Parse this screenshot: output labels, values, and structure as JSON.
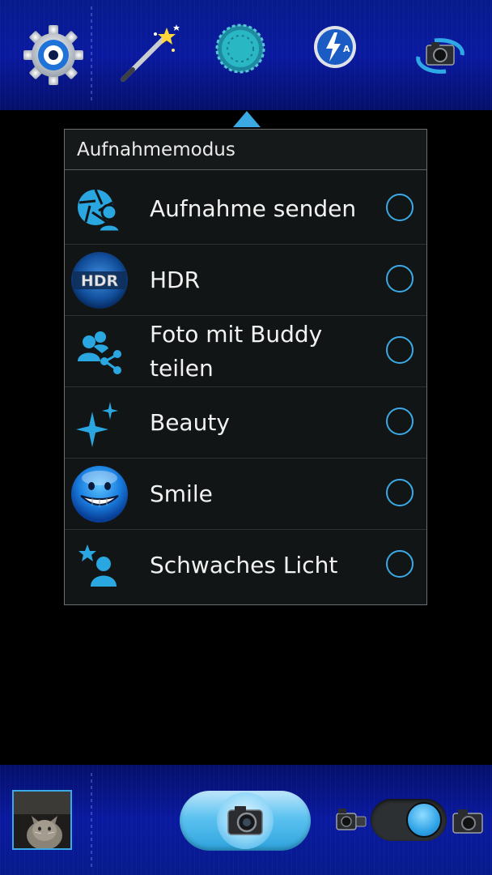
{
  "toolbar": {
    "icons": [
      "settings-gear-icon",
      "magic-wand-icon",
      "scene-mode-dial-icon",
      "flash-auto-icon",
      "switch-camera-icon"
    ],
    "accent_color": "#3aa9e4"
  },
  "popup": {
    "title": "Aufnahmemodus",
    "items": [
      {
        "label": "Aufnahme senden",
        "icon": "shutter-share-icon",
        "selected": false
      },
      {
        "label": "HDR",
        "icon": "hdr-icon",
        "selected": false
      },
      {
        "label": "Foto mit Buddy teilen",
        "icon": "buddy-share-icon",
        "selected": false
      },
      {
        "label": "Beauty",
        "icon": "sparkle-icon",
        "selected": false
      },
      {
        "label": "Smile",
        "icon": "smiley-icon",
        "selected": false
      },
      {
        "label": "Schwaches Licht",
        "icon": "low-light-icon",
        "selected": false
      }
    ]
  },
  "bottombar": {
    "gallery_thumbnail": "gallery-thumbnail",
    "shutter": "camera-shutter-icon",
    "mode_toggle": {
      "left_icon": "video-camera-icon",
      "right_icon": "photo-camera-icon",
      "position": "photo"
    }
  }
}
